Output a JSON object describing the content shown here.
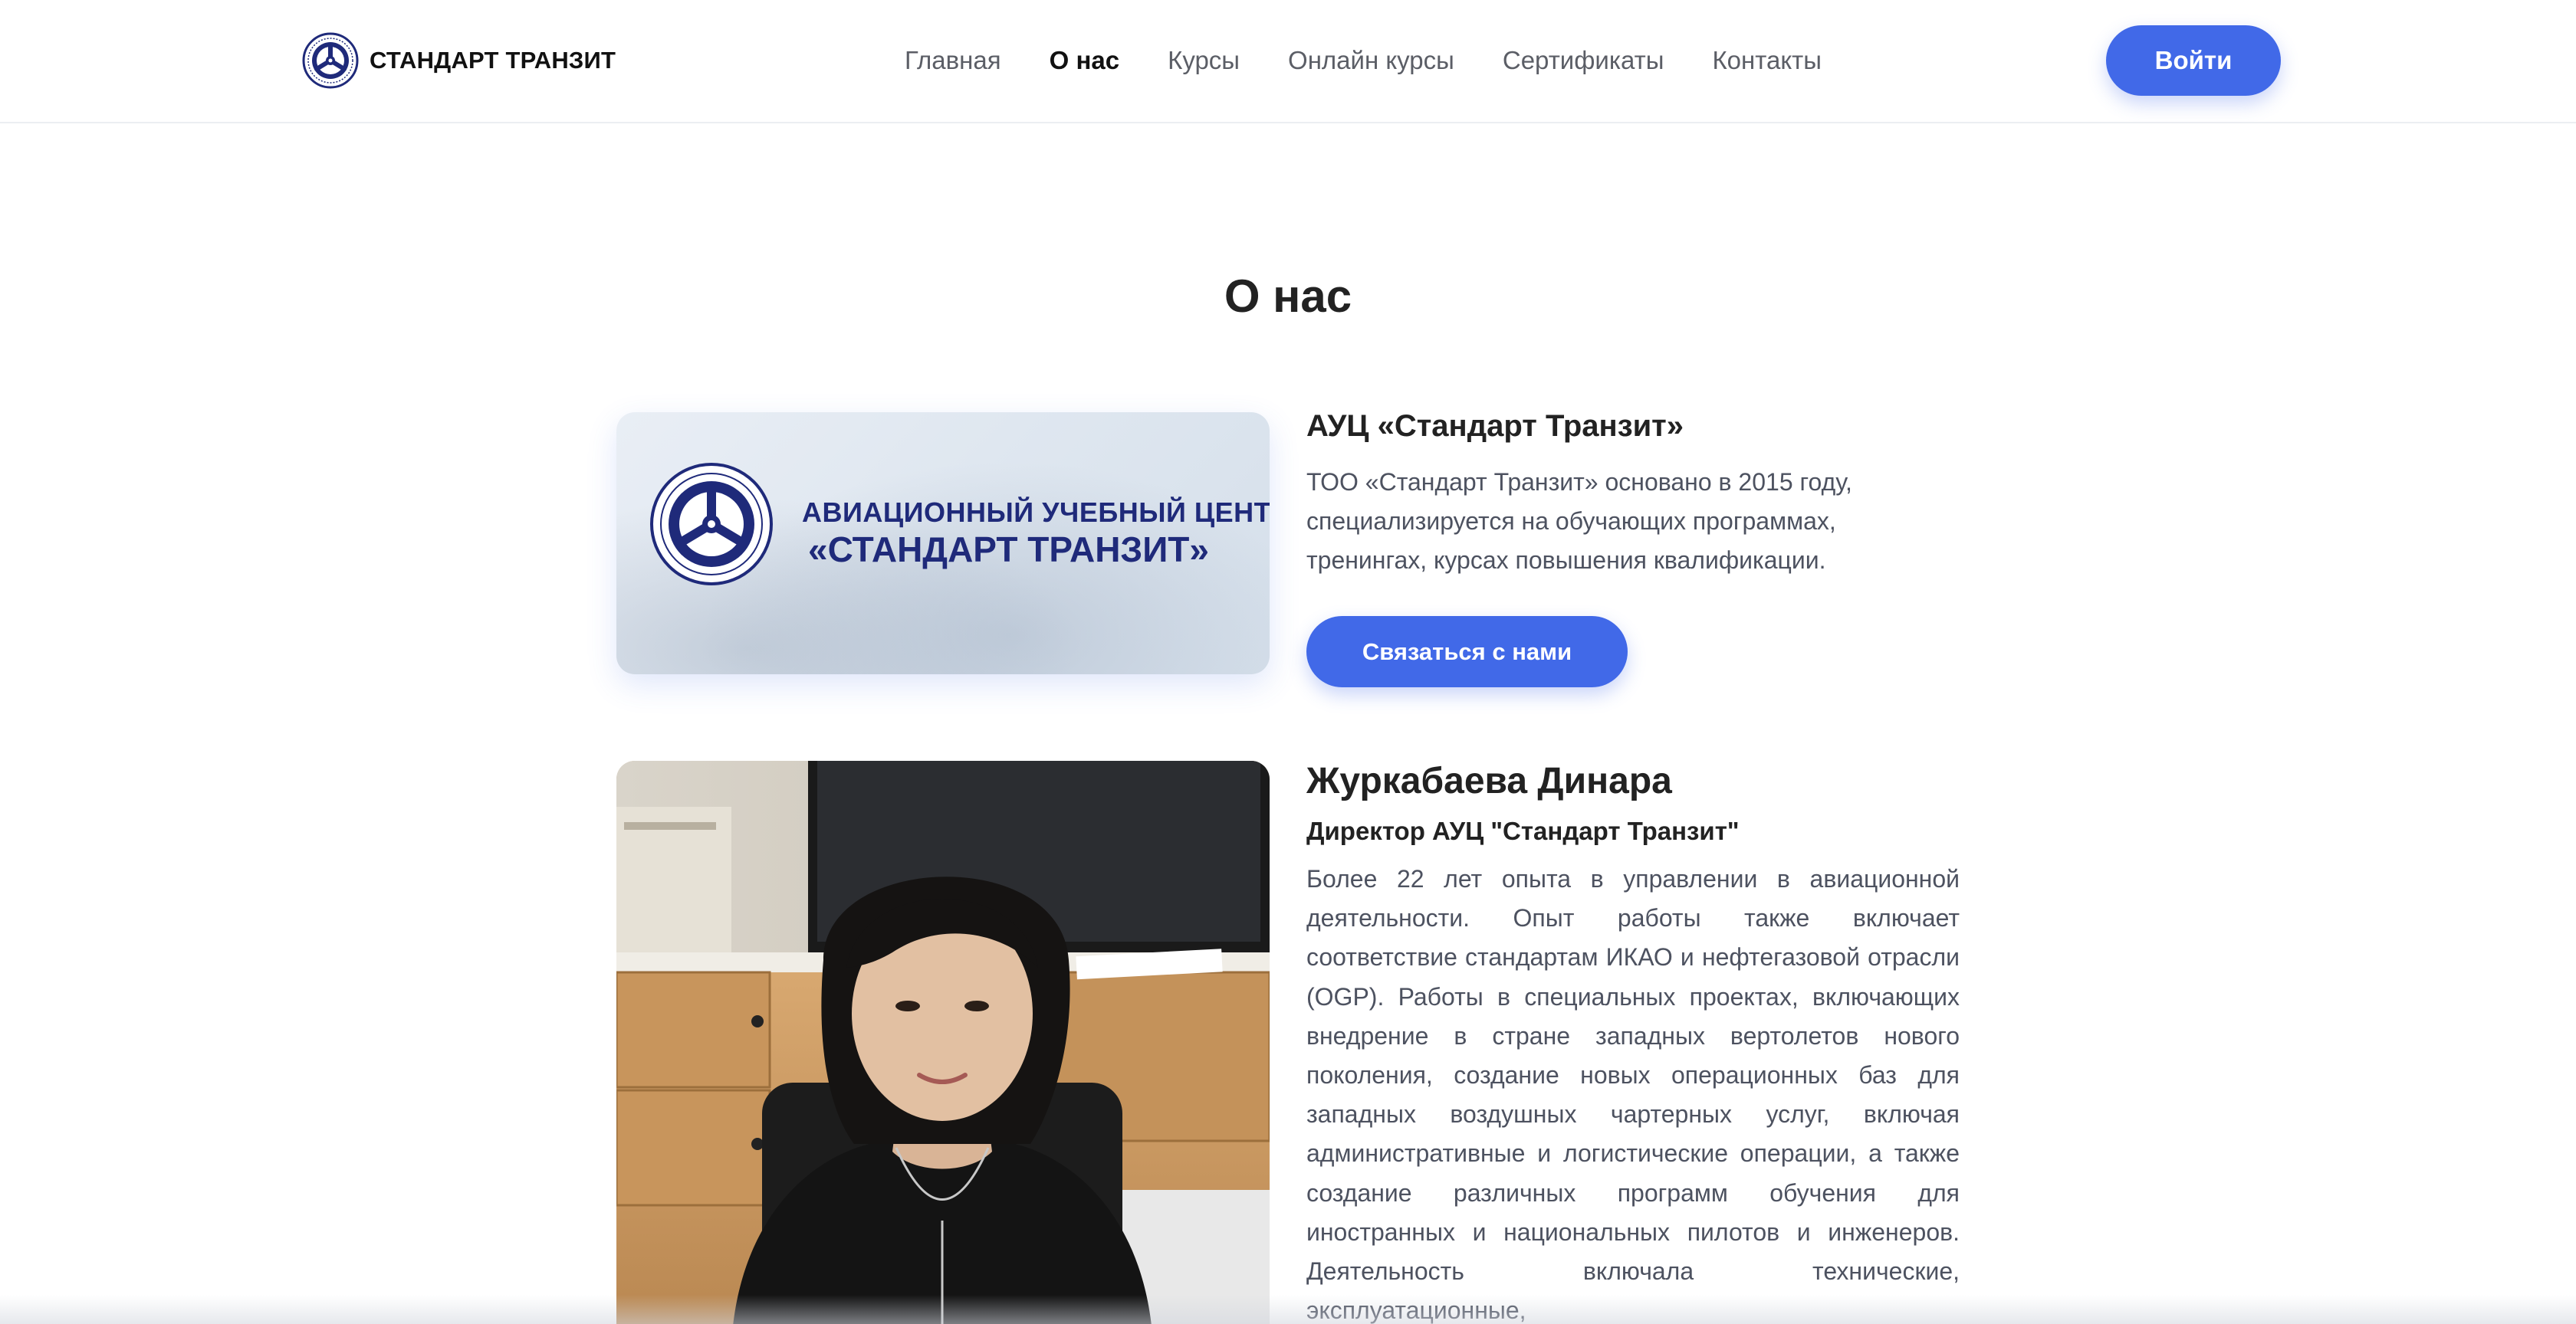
{
  "header": {
    "logo_text": "СТАНДАРТ ТРАНЗИТ",
    "nav": [
      {
        "label": "Главная",
        "active": false
      },
      {
        "label": "О нас",
        "active": true
      },
      {
        "label": "Курсы",
        "active": false
      },
      {
        "label": "Онлайн курсы",
        "active": false
      },
      {
        "label": "Сертификаты",
        "active": false
      },
      {
        "label": "Контакты",
        "active": false
      }
    ],
    "login_label": "Войти"
  },
  "section_title": "О нас",
  "company": {
    "image_line1": "АВИАЦИОННЫЙ УЧЕБНЫЙ  ЦЕНТР",
    "image_line2": "«СТАНДАРТ ТРАНЗИТ»",
    "name": "АУЦ «Стандарт Транзит»",
    "description": "ТОО «Стандарт Транзит» основано в 2015 году, специализируется на обучающих программах, тренингах, курсах повышения квалификации.",
    "contact_label": "Связаться с нами"
  },
  "person": {
    "name": "Журкабаева Динара",
    "role": "Директор АУЦ \"Стандарт Транзит\"",
    "bio": "Более 22 лет опыта в управлении в авиационной деятельности. Опыт работы также включает соответствие стандартам ИКАО и нефтегазовой отрасли (OGP). Работы в специальных проектах, включающих внедрение в стране западных вертолетов нового поколения, создание новых операционных баз для западных воздушных чартерных услуг, включая административные и логистические операции, а также создание различных программ обучения для иностранных и национальных пилотов и инженеров. Деятельность включала технические, эксплуатационные,"
  },
  "colors": {
    "accent": "#4169e8",
    "text_dark": "#222222",
    "text_body": "#4d5260",
    "logo_navy": "#1f2a7a"
  }
}
